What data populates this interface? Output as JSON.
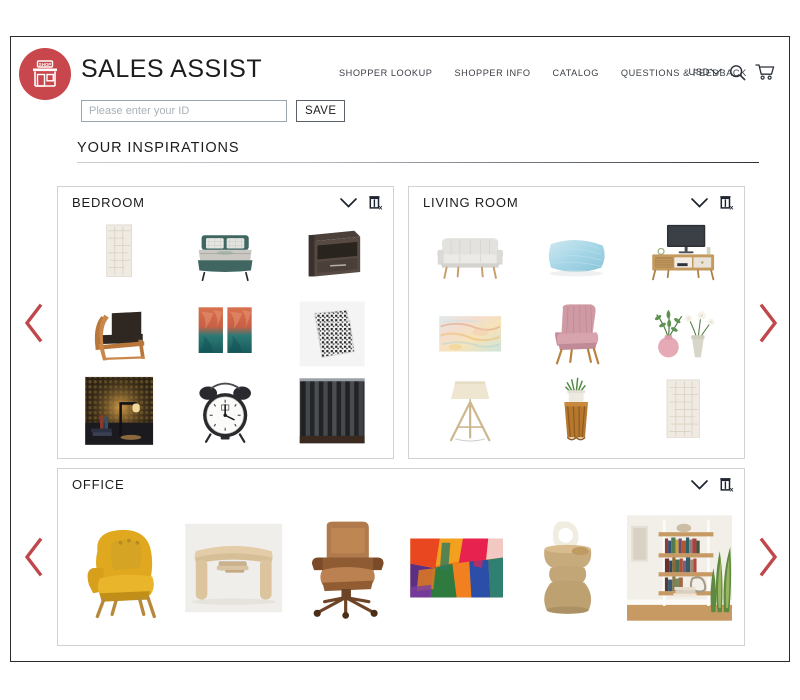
{
  "brand": {
    "title": "SALES ASSIST",
    "logo_icon": "shop-storefront-icon",
    "logo_label": "SHOP",
    "logo_color": "#c8474c"
  },
  "nav": {
    "items": [
      {
        "label": "SHOPPER LOOKUP"
      },
      {
        "label": "SHOPPER INFO"
      },
      {
        "label": "CATALOG"
      },
      {
        "label": "QUESTIONS & FEEDBACK"
      }
    ]
  },
  "header_tools": {
    "currency": "USD",
    "currency_chevron_icon": "chevron-down-icon",
    "search_icon": "search-icon",
    "cart_icon": "shopping-cart-icon"
  },
  "id_form": {
    "placeholder": "Please enter your ID",
    "value": "",
    "save_label": "SAVE"
  },
  "section": {
    "title": "YOUR INSPIRATIONS"
  },
  "carousel": {
    "prev_icon": "chevron-left-icon",
    "next_icon": "chevron-right-icon",
    "arrow_color": "#c0474c"
  },
  "card_actions": {
    "collapse_icon": "chevron-down-icon",
    "delete_icon": "trash-delete-icon"
  },
  "boards": [
    {
      "title": "BEDROOM",
      "layout": "3x3",
      "items": [
        {
          "name": "woven-area-rug"
        },
        {
          "name": "upholstered-platform-bed"
        },
        {
          "name": "dark-wood-nightstand"
        },
        {
          "name": "leather-wood-armchair"
        },
        {
          "name": "abstract-diptych-wall-art"
        },
        {
          "name": "patterned-throw-pillow"
        },
        {
          "name": "industrial-table-lamp"
        },
        {
          "name": "twin-bell-alarm-clock"
        },
        {
          "name": "pleated-blackout-curtains"
        }
      ]
    },
    {
      "title": "LIVING ROOM",
      "layout": "3x3",
      "items": [
        {
          "name": "light-grey-sofa"
        },
        {
          "name": "blue-satin-cushion"
        },
        {
          "name": "mid-century-tv-console"
        },
        {
          "name": "pastel-abstract-canvas"
        },
        {
          "name": "pink-velvet-accent-chair"
        },
        {
          "name": "ceramic-vases-with-greenery"
        },
        {
          "name": "tripod-floor-lamp"
        },
        {
          "name": "wood-stump-side-table"
        },
        {
          "name": "textured-ivory-rug"
        }
      ]
    },
    {
      "title": "OFFICE",
      "layout": "1x6",
      "items": [
        {
          "name": "yellow-velvet-armchair"
        },
        {
          "name": "light-oak-writing-desk"
        },
        {
          "name": "brown-leather-office-chair"
        },
        {
          "name": "colorful-abstract-painting"
        },
        {
          "name": "stacked-ceramic-sculpture"
        },
        {
          "name": "styled-bookshelf-photo"
        }
      ]
    }
  ]
}
